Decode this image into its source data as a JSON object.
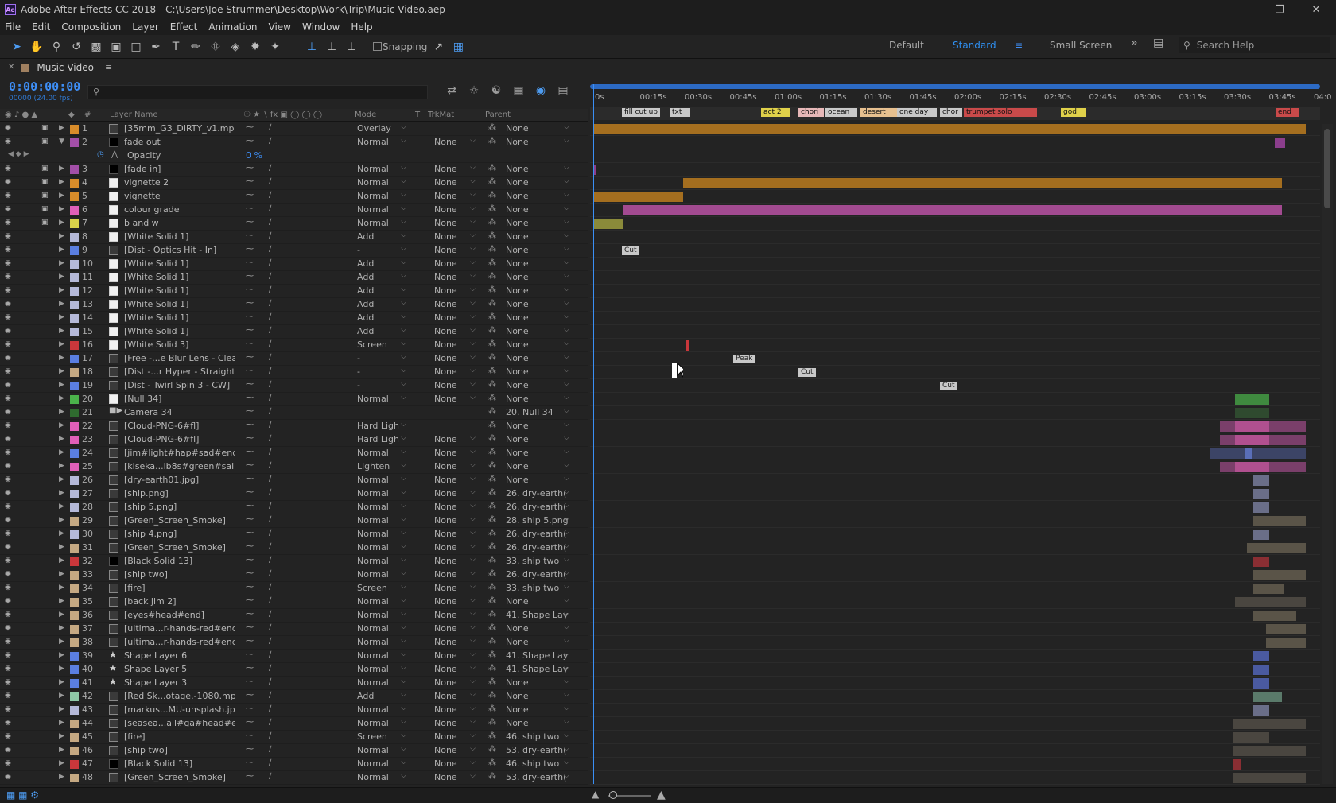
{
  "app": {
    "title": "Adobe After Effects CC 2018 - C:\\Users\\Joe Strummer\\Desktop\\Work\\Trip\\Music Video.aep",
    "icon_text": "Ae"
  },
  "menu": [
    "File",
    "Edit",
    "Composition",
    "Layer",
    "Effect",
    "Animation",
    "View",
    "Window",
    "Help"
  ],
  "toolbar": {
    "snapping_label": "Snapping",
    "workspaces": [
      "Default",
      "Standard",
      "Small Screen"
    ],
    "active_workspace": "Standard",
    "search_placeholder": "Search Help"
  },
  "comp_tab": {
    "label": "Music Video"
  },
  "timeline": {
    "timecode": "0:00:00:00",
    "frames": "00000 (24.00 fps)",
    "ruler_ticks": [
      "0s",
      "00:15s",
      "00:30s",
      "00:45s",
      "01:00s",
      "01:15s",
      "01:30s",
      "01:45s",
      "02:00s",
      "02:15s",
      "02:30s",
      "02:45s",
      "03:00s",
      "03:15s",
      "03:30s",
      "03:45s",
      "04:0"
    ],
    "markers": [
      {
        "text": "fill cut up",
        "color": "#c9c9c9"
      },
      {
        "text": "txt",
        "color": "#c9c9c9"
      },
      {
        "text": "act 2",
        "color": "#e0d14a"
      },
      {
        "text": "chori",
        "color": "#e7b8b8"
      },
      {
        "text": "ocean",
        "color": "#c9c9c9"
      },
      {
        "text": "desert",
        "color": "#e7c08f"
      },
      {
        "text": "one day",
        "color": "#c9c9c9"
      },
      {
        "text": "chor",
        "color": "#c9c9c9"
      },
      {
        "text": "trumpet solo",
        "color": "#c94a4a"
      },
      {
        "text": "god",
        "color": "#e0d14a"
      },
      {
        "text": "end",
        "color": "#c94a4a"
      }
    ],
    "keyframe_labels": [
      "Cut",
      "Peak",
      "Cut",
      "Cut"
    ],
    "opacity_value": "0 %"
  },
  "columns": {
    "num": "#",
    "layer_name": "Layer Name",
    "mode": "Mode",
    "t": "T",
    "trkmat": "TrkMat",
    "parent": "Parent"
  },
  "layers": [
    {
      "num": "1",
      "name": "[35mm_G3_DIRTY_v1.mp4]",
      "color": "#d88c2a",
      "src": "footage",
      "mode": "Overlay",
      "trk": "",
      "parent": "None",
      "lock": true
    },
    {
      "num": "2",
      "name": "fade out",
      "color": "#a34fa8",
      "src": "black",
      "mode": "Normal",
      "trk": "None",
      "parent": "None",
      "lock": true,
      "open": true
    },
    {
      "num": "",
      "name": "Opacity",
      "color": "",
      "src": "prop",
      "mode": "",
      "trk": "",
      "parent": "",
      "prop": true
    },
    {
      "num": "3",
      "name": "[fade in]",
      "color": "#a34fa8",
      "src": "black",
      "mode": "Normal",
      "trk": "None",
      "parent": "None",
      "lock": true
    },
    {
      "num": "4",
      "name": "vignette 2",
      "color": "#d88c2a",
      "src": "white",
      "mode": "Normal",
      "trk": "None",
      "parent": "None",
      "lock": true
    },
    {
      "num": "5",
      "name": "vignette",
      "color": "#d88c2a",
      "src": "white",
      "mode": "Normal",
      "trk": "None",
      "parent": "None",
      "lock": true
    },
    {
      "num": "6",
      "name": "colour grade",
      "color": "#e05fb8",
      "src": "white",
      "mode": "Normal",
      "trk": "None",
      "parent": "None",
      "lock": true
    },
    {
      "num": "7",
      "name": "b and w",
      "color": "#d9d24a",
      "src": "white",
      "mode": "Normal",
      "trk": "None",
      "parent": "None",
      "lock": true
    },
    {
      "num": "8",
      "name": "[White Solid 1]",
      "color": "#b4b8d8",
      "src": "white",
      "mode": "Add",
      "trk": "None",
      "parent": "None"
    },
    {
      "num": "9",
      "name": "[Dist - Optics Hit - In]",
      "color": "#5a7ee0",
      "src": "footage",
      "mode": "-",
      "trk": "None",
      "parent": "None"
    },
    {
      "num": "10",
      "name": "[White Solid 1]",
      "color": "#b4b8d8",
      "src": "white",
      "mode": "Add",
      "trk": "None",
      "parent": "None"
    },
    {
      "num": "11",
      "name": "[White Solid 1]",
      "color": "#b4b8d8",
      "src": "white",
      "mode": "Add",
      "trk": "None",
      "parent": "None"
    },
    {
      "num": "12",
      "name": "[White Solid 1]",
      "color": "#b4b8d8",
      "src": "white",
      "mode": "Add",
      "trk": "None",
      "parent": "None"
    },
    {
      "num": "13",
      "name": "[White Solid 1]",
      "color": "#b4b8d8",
      "src": "white",
      "mode": "Add",
      "trk": "None",
      "parent": "None"
    },
    {
      "num": "14",
      "name": "[White Solid 1]",
      "color": "#b4b8d8",
      "src": "white",
      "mode": "Add",
      "trk": "None",
      "parent": "None"
    },
    {
      "num": "15",
      "name": "[White Solid 1]",
      "color": "#b4b8d8",
      "src": "white",
      "mode": "Add",
      "trk": "None",
      "parent": "None"
    },
    {
      "num": "16",
      "name": "[White Solid 3]",
      "color": "#c9373b",
      "src": "white",
      "mode": "Screen",
      "trk": "None",
      "parent": "None"
    },
    {
      "num": "17",
      "name": "[Free -...e Blur Lens - Clean]",
      "color": "#5a7ee0",
      "src": "footage",
      "mode": "-",
      "trk": "None",
      "parent": "None"
    },
    {
      "num": "18",
      "name": "[Dist -...r Hyper - Straight_1]",
      "color": "#c4a882",
      "src": "footage",
      "mode": "-",
      "trk": "None",
      "parent": "None"
    },
    {
      "num": "19",
      "name": "[Dist - Twirl Spin 3 - CW]",
      "color": "#5a7ee0",
      "src": "footage",
      "mode": "-",
      "trk": "None",
      "parent": "None"
    },
    {
      "num": "20",
      "name": "[Null 34]",
      "color": "#4bb34b",
      "src": "white",
      "mode": "Normal",
      "trk": "None",
      "parent": "None"
    },
    {
      "num": "21",
      "name": "Camera 34",
      "color": "#2f6b2f",
      "src": "cam",
      "mode": "",
      "trk": "",
      "parent": "20. Null 34"
    },
    {
      "num": "22",
      "name": "[Cloud-PNG-6#fl]",
      "color": "#e05fb8",
      "src": "footage",
      "mode": "Hard Ligh",
      "trk": "",
      "parent": "None"
    },
    {
      "num": "23",
      "name": "[Cloud-PNG-6#fl]",
      "color": "#e05fb8",
      "src": "footage",
      "mode": "Hard Ligh",
      "trk": "None",
      "parent": "None"
    },
    {
      "num": "24",
      "name": "[jim#light#hap#sad#end]",
      "color": "#5a7ee0",
      "src": "footage",
      "mode": "Normal",
      "trk": "None",
      "parent": "None"
    },
    {
      "num": "25",
      "name": "[kiseka...ib8s#green#sail#fl]",
      "color": "#e05fb8",
      "src": "footage",
      "mode": "Lighten",
      "trk": "None",
      "parent": "None"
    },
    {
      "num": "26",
      "name": "[dry-earth01.jpg]",
      "color": "#b4b8d8",
      "src": "footage",
      "mode": "Normal",
      "trk": "None",
      "parent": "None"
    },
    {
      "num": "27",
      "name": "[ship.png]",
      "color": "#b4b8d8",
      "src": "png",
      "mode": "Normal",
      "trk": "None",
      "parent": "26. dry-earth("
    },
    {
      "num": "28",
      "name": "[ship 5.png]",
      "color": "#b4b8d8",
      "src": "png",
      "mode": "Normal",
      "trk": "None",
      "parent": "26. dry-earth("
    },
    {
      "num": "29",
      "name": "[Green_Screen_Smoke]",
      "color": "#c4a882",
      "src": "footage",
      "mode": "Normal",
      "trk": "None",
      "parent": "28. ship 5.png"
    },
    {
      "num": "30",
      "name": "[ship 4.png]",
      "color": "#b4b8d8",
      "src": "png",
      "mode": "Normal",
      "trk": "None",
      "parent": "26. dry-earth("
    },
    {
      "num": "31",
      "name": "[Green_Screen_Smoke]",
      "color": "#c4a882",
      "src": "footage",
      "mode": "Normal",
      "trk": "None",
      "parent": "26. dry-earth("
    },
    {
      "num": "32",
      "name": "[Black Solid 13]",
      "color": "#c9373b",
      "src": "black",
      "mode": "Normal",
      "trk": "None",
      "parent": "33. ship two"
    },
    {
      "num": "33",
      "name": "[ship two]",
      "color": "#c4a882",
      "src": "footage",
      "mode": "Normal",
      "trk": "None",
      "parent": "26. dry-earth("
    },
    {
      "num": "34",
      "name": "[fire]",
      "color": "#c4a882",
      "src": "footage",
      "mode": "Screen",
      "trk": "None",
      "parent": "33. ship two"
    },
    {
      "num": "35",
      "name": "[back jim 2]",
      "color": "#c4a882",
      "src": "footage",
      "mode": "Normal",
      "trk": "None",
      "parent": "None"
    },
    {
      "num": "36",
      "name": "[eyes#head#end]",
      "color": "#c4a882",
      "src": "footage",
      "mode": "Normal",
      "trk": "None",
      "parent": "41. Shape Lay"
    },
    {
      "num": "37",
      "name": "[ultima...r-hands-red#end]",
      "color": "#c4a882",
      "src": "footage",
      "mode": "Normal",
      "trk": "None",
      "parent": "None"
    },
    {
      "num": "38",
      "name": "[ultima...r-hands-red#end]",
      "color": "#c4a882",
      "src": "footage",
      "mode": "Normal",
      "trk": "None",
      "parent": "None"
    },
    {
      "num": "39",
      "name": "Shape Layer 6",
      "color": "#5a7ee0",
      "src": "star",
      "mode": "Normal",
      "trk": "None",
      "parent": "41. Shape Lay"
    },
    {
      "num": "40",
      "name": "Shape Layer 5",
      "color": "#5a7ee0",
      "src": "star",
      "mode": "Normal",
      "trk": "None",
      "parent": "41. Shape Lay"
    },
    {
      "num": "41",
      "name": "Shape Layer 3",
      "color": "#5a7ee0",
      "src": "star",
      "mode": "Normal",
      "trk": "None",
      "parent": "None"
    },
    {
      "num": "42",
      "name": "[Red Sk...otage.-1080.mp4]",
      "color": "#8fc9a8",
      "src": "footage",
      "mode": "Add",
      "trk": "None",
      "parent": "None"
    },
    {
      "num": "43",
      "name": "[markus...MU-unsplash.jpg]",
      "color": "#b4b8d8",
      "src": "png",
      "mode": "Normal",
      "trk": "None",
      "parent": "None"
    },
    {
      "num": "44",
      "name": "[seasea...ail#ga#head#end]",
      "color": "#c4a882",
      "src": "footage",
      "mode": "Normal",
      "trk": "None",
      "parent": "None"
    },
    {
      "num": "45",
      "name": "[fire]",
      "color": "#c4a882",
      "src": "footage",
      "mode": "Screen",
      "trk": "None",
      "parent": "46. ship two"
    },
    {
      "num": "46",
      "name": "[ship two]",
      "color": "#c4a882",
      "src": "footage",
      "mode": "Normal",
      "trk": "None",
      "parent": "53. dry-earth("
    },
    {
      "num": "47",
      "name": "[Black Solid 13]",
      "color": "#c9373b",
      "src": "black",
      "mode": "Normal",
      "trk": "None",
      "parent": "46. ship two"
    },
    {
      "num": "48",
      "name": "[Green_Screen_Smoke]",
      "color": "#c4a882",
      "src": "footage",
      "mode": "Normal",
      "trk": "None",
      "parent": "53. dry-earth("
    }
  ],
  "colors": {
    "accent": "#2f8ff0",
    "timecode": "#3e8ef5",
    "orange": "#b07622",
    "pink": "#b0508f",
    "olive": "#8a8a3a"
  }
}
